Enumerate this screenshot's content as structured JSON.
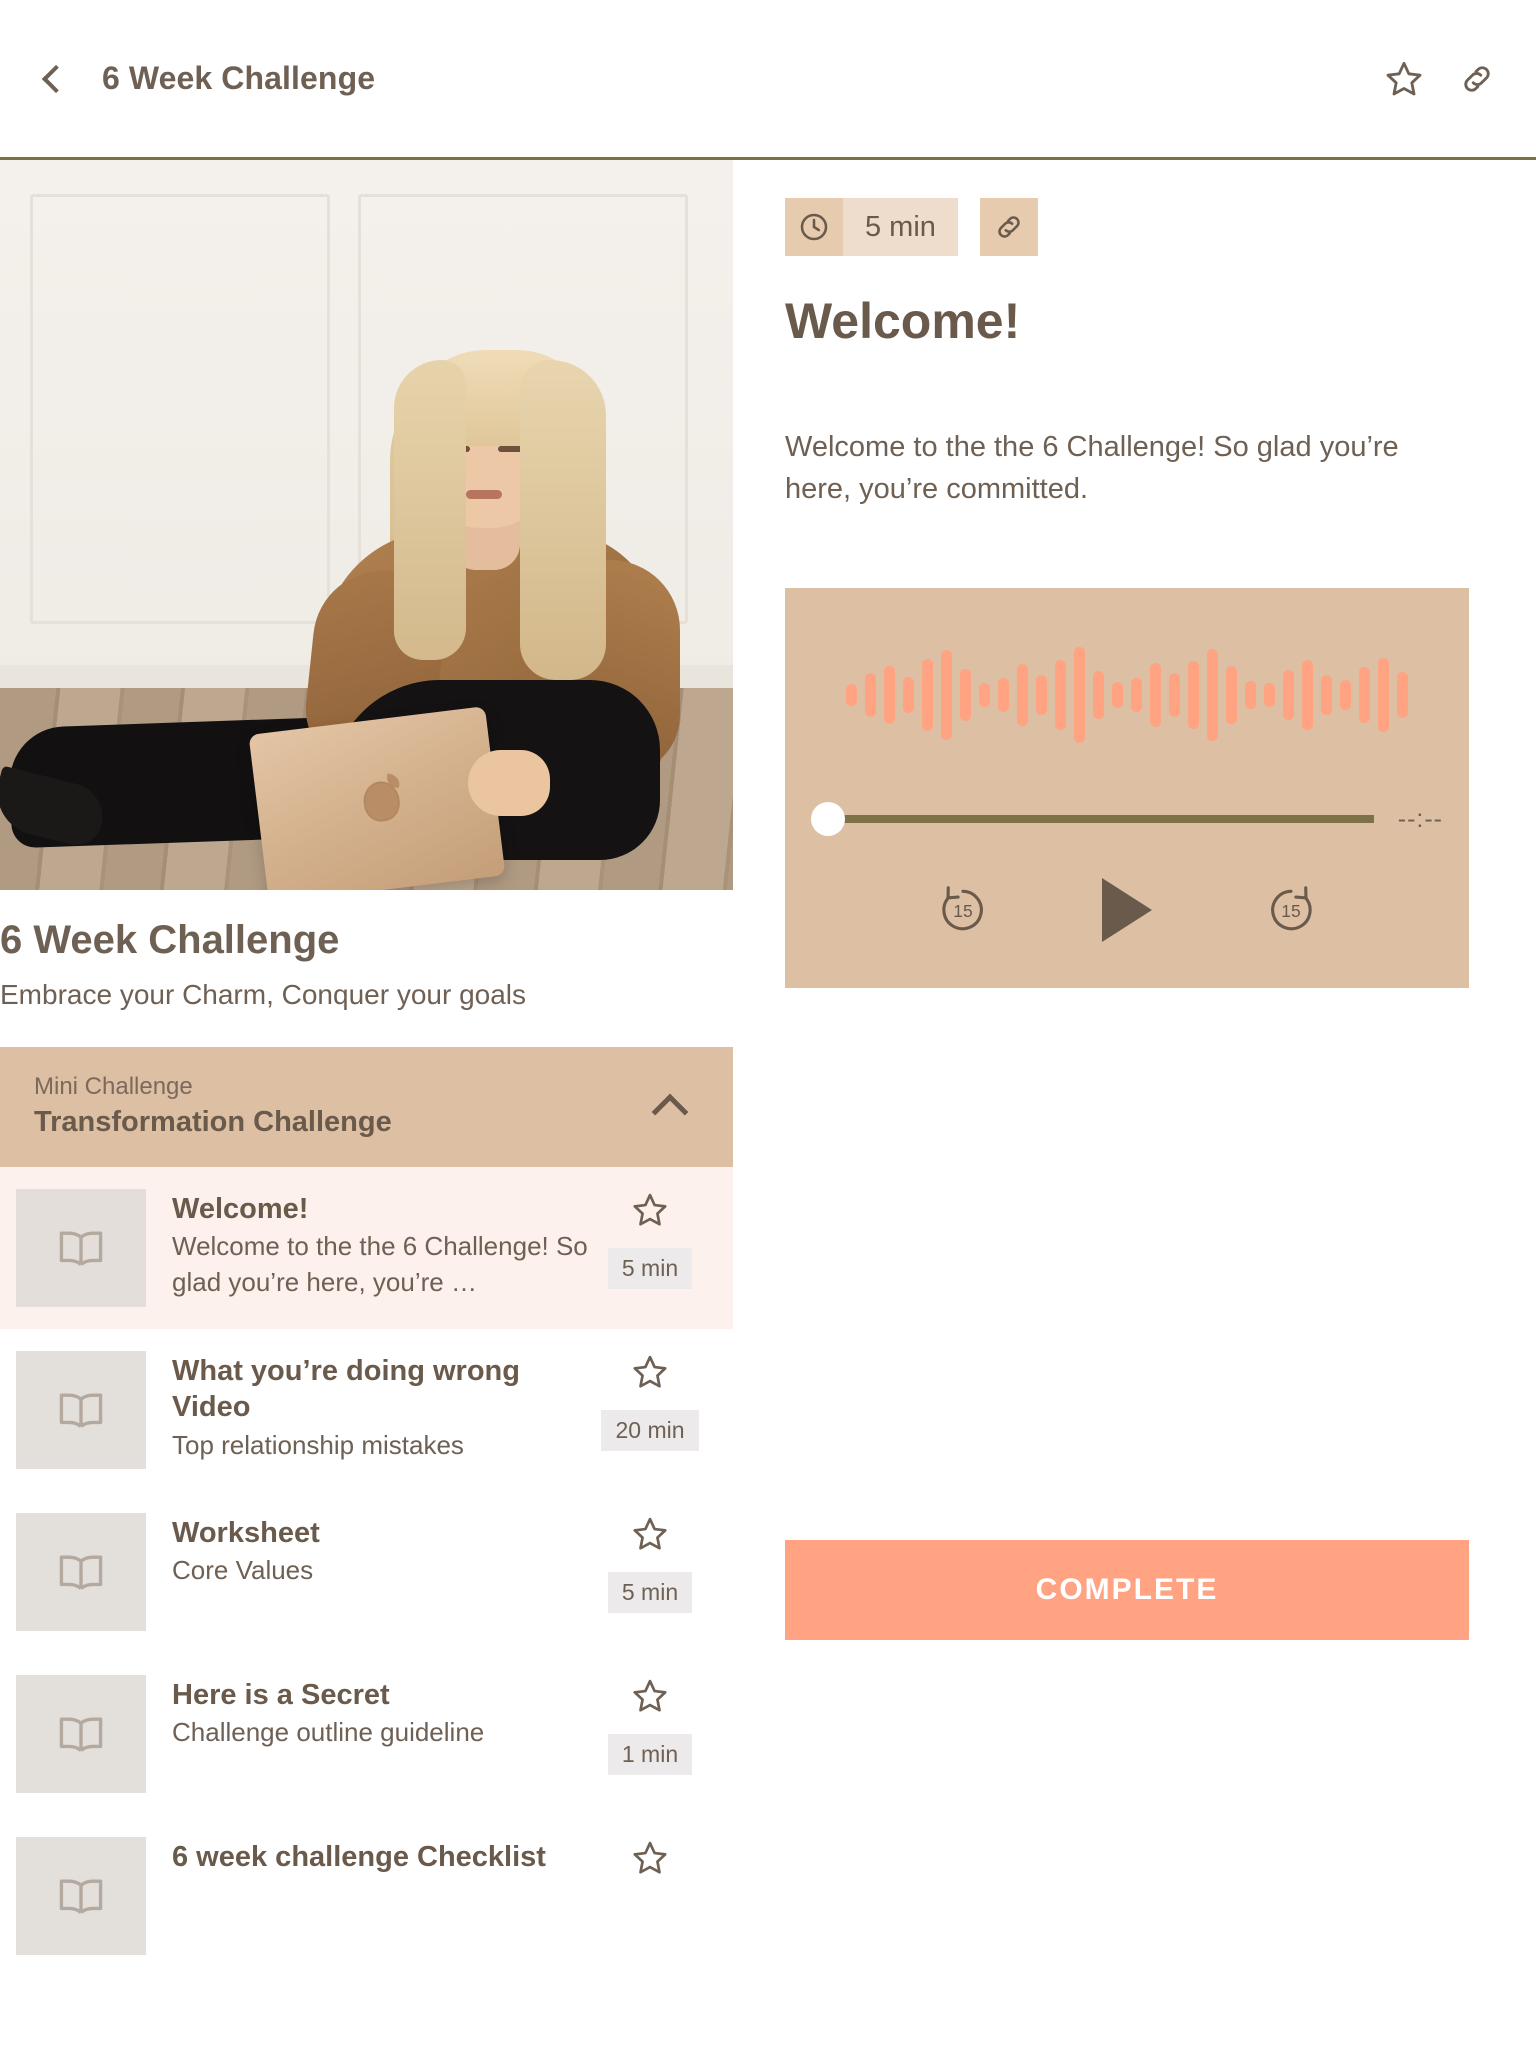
{
  "header": {
    "title": "6 Week Challenge",
    "back_icon": "chevron-left-icon",
    "favorite_icon": "star-outline-icon",
    "share_icon": "link-icon"
  },
  "course": {
    "title": "6 Week Challenge",
    "subtitle": "Embrace your Charm, Conquer your goals",
    "hero_alt": "woman-sitting-on-floor-with-laptop"
  },
  "section": {
    "kicker": "Mini Challenge",
    "name": "Transformation Challenge",
    "collapse_icon": "chevron-up-icon",
    "expanded": true
  },
  "lessons": [
    {
      "title": "Welcome!",
      "description": "Welcome to the the 6 Challenge! So glad you’re here, you’re …",
      "duration": "5 min",
      "icon": "book-open-icon",
      "favorite_icon": "star-outline-icon",
      "active": true
    },
    {
      "title": "What you’re doing wrong Video",
      "description": "Top relationship mistakes",
      "duration": "20 min",
      "icon": "book-open-icon",
      "favorite_icon": "star-outline-icon",
      "active": false
    },
    {
      "title": "Worksheet",
      "description": "Core Values",
      "duration": "5 min",
      "icon": "book-open-icon",
      "favorite_icon": "star-outline-icon",
      "active": false
    },
    {
      "title": "Here is a Secret",
      "description": "Challenge outline guideline",
      "duration": "1 min",
      "icon": "book-open-icon",
      "favorite_icon": "star-outline-icon",
      "active": false
    },
    {
      "title": "6 week challenge Checklist",
      "description": "",
      "duration": "",
      "icon": "book-open-icon",
      "favorite_icon": "star-outline-icon",
      "active": false
    }
  ],
  "detail": {
    "duration": "5 min",
    "clock_icon": "clock-icon",
    "share_icon": "link-icon",
    "heading": "Welcome!",
    "body": "Welcome to the the 6 Challenge! So glad you’re here, you’re committed."
  },
  "player": {
    "current_time": "--:--",
    "progress_percent": 0,
    "rewind_label": "15",
    "forward_label": "15",
    "rewind_icon": "rewind-15-icon",
    "play_icon": "play-icon",
    "forward_icon": "forward-15-icon",
    "waveform": [
      22,
      44,
      58,
      36,
      72,
      90,
      52,
      24,
      34,
      62,
      40,
      70,
      96,
      48,
      26,
      34,
      64,
      44,
      68,
      92,
      58,
      28,
      24,
      50,
      70,
      40,
      30,
      56,
      74,
      46
    ]
  },
  "actions": {
    "complete_label": "COMPLETE"
  },
  "colors": {
    "accent_tan": "#ddbfa3",
    "accent_tan_light": "#eeddcc",
    "brand_brown": "#6a5a4c",
    "olive_rule": "#7d7247",
    "coral": "#ffa383",
    "active_row": "#fdf1ee"
  }
}
